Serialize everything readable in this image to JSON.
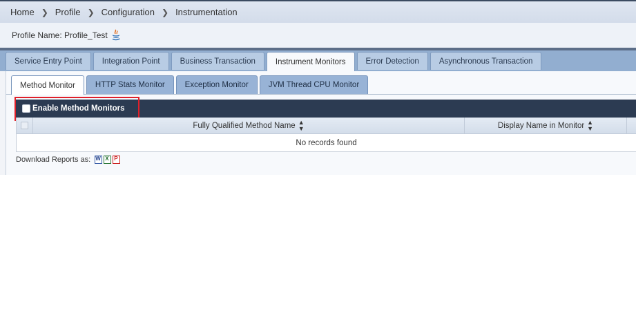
{
  "breadcrumb": {
    "items": [
      "Home",
      "Profile",
      "Configuration",
      "Instrumentation"
    ],
    "separator": ">"
  },
  "profile": {
    "label": "Profile Name: Profile_Test",
    "icon": "java-icon"
  },
  "main_tabs": [
    {
      "label": "Service Entry Point",
      "active": false
    },
    {
      "label": "Integration Point",
      "active": false
    },
    {
      "label": "Business Transaction",
      "active": false
    },
    {
      "label": "Instrument Monitors",
      "active": true
    },
    {
      "label": "Error Detection",
      "active": false
    },
    {
      "label": "Asynchronous Transaction",
      "active": false
    }
  ],
  "sub_tabs": [
    {
      "label": "Method Monitor",
      "active": true
    },
    {
      "label": "HTTP Stats Monitor",
      "active": false
    },
    {
      "label": "Exception Monitor",
      "active": false
    },
    {
      "label": "JVM Thread CPU Monitor",
      "active": false
    }
  ],
  "panel": {
    "enable_label": "Enable Method Monitors",
    "enable_checked": false
  },
  "table": {
    "columns": [
      "Fully Qualified Method Name",
      "Display Name in Monitor"
    ],
    "empty_message": "No records found"
  },
  "download": {
    "label": "Download Reports as:",
    "formats": [
      "word-icon",
      "excel-icon",
      "pdf-icon"
    ]
  },
  "colors": {
    "panel_header": "#2c3b52",
    "highlight": "#e0202a",
    "tab_bar": "#92aed0"
  }
}
